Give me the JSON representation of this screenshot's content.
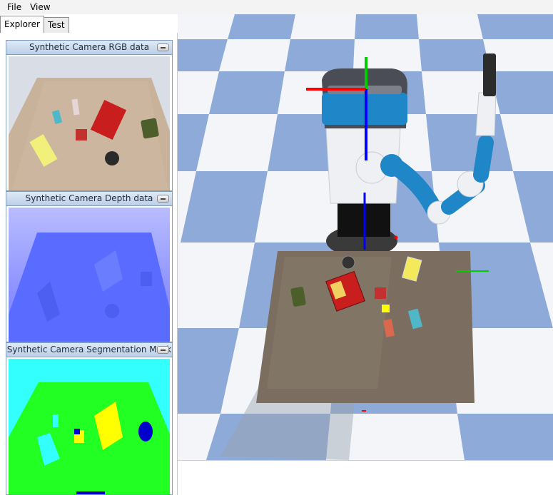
{
  "menu": {
    "file": "File",
    "view": "View"
  },
  "tabs": [
    {
      "label": "Explorer",
      "active": true
    },
    {
      "label": "Test",
      "active": false
    }
  ],
  "panels": {
    "rgb": {
      "title": "Synthetic Camera RGB data"
    },
    "depth": {
      "title": "Synthetic Camera Depth data"
    },
    "segmentation": {
      "title": "Synthetic Camera Segmentation Mask"
    }
  },
  "icons": {
    "minimize": "minimize-icon"
  },
  "colors": {
    "floor_blue": "#8eaad8",
    "floor_white": "#f2f4f8",
    "robot_blue": "#1f86c8",
    "segmentation_cyan": "#33ffff",
    "segmentation_green": "#22ff22",
    "segmentation_yellow": "#ffff00",
    "depth_blue": "#5a6cff",
    "axis_red": "#ff0000",
    "axis_green": "#00cc00",
    "axis_blue": "#0000ff"
  }
}
